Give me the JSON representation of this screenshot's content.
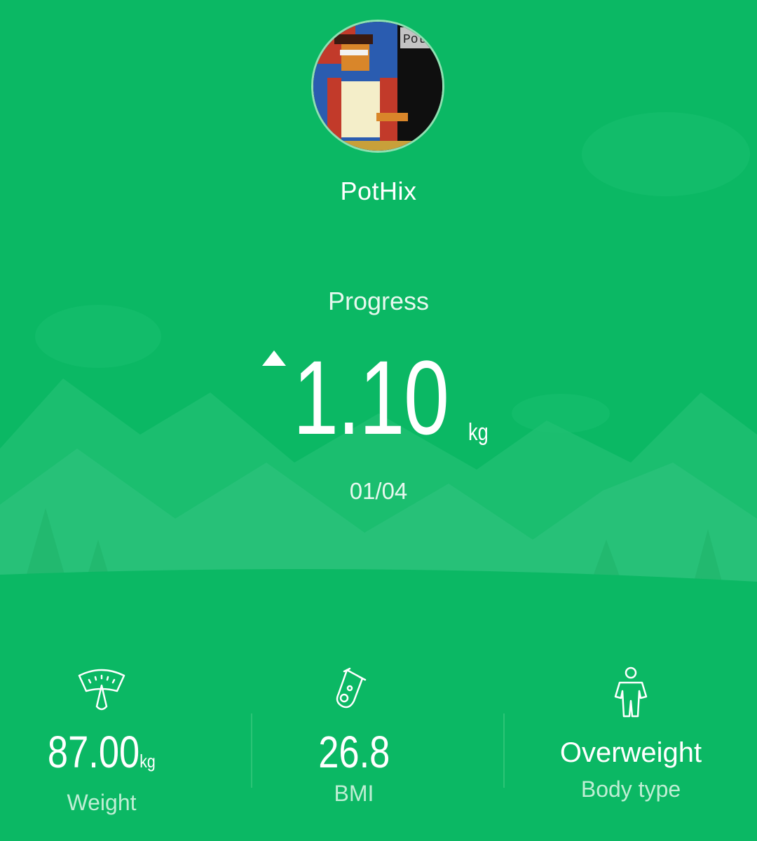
{
  "profile": {
    "avatar_label": "Pot",
    "username": "PotHix"
  },
  "progress": {
    "label": "Progress",
    "trend": "up",
    "value": "1.10",
    "unit": "kg",
    "date": "01/04"
  },
  "stats": {
    "weight": {
      "icon": "scale-icon",
      "value": "87.00",
      "unit": "kg",
      "label": "Weight"
    },
    "bmi": {
      "icon": "flask-icon",
      "value": "26.8",
      "label": "BMI"
    },
    "body_type": {
      "icon": "body-icon",
      "value": "Overweight",
      "label": "Body type"
    }
  },
  "colors": {
    "background": "#0bb864",
    "text": "#ffffff",
    "secondary_text": "#bfeed4"
  }
}
